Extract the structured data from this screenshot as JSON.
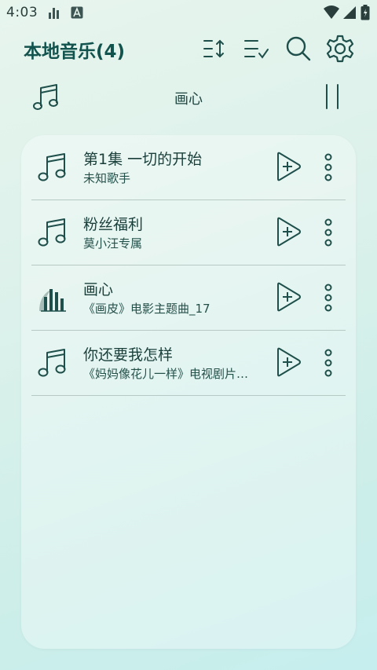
{
  "status_bar": {
    "time": "4:03",
    "icons_left": [
      "signal-bars-icon",
      "accessibility-a-icon"
    ],
    "icons_right": [
      "wifi-icon",
      "cell-signal-icon",
      "battery-icon"
    ]
  },
  "header": {
    "title": "本地音乐(4)",
    "actions": [
      "sort-icon",
      "multi-select-icon",
      "search-icon",
      "gear-icon"
    ]
  },
  "now_playing": {
    "title": "画心",
    "state_icon": "pause-icon"
  },
  "songs": [
    {
      "title": "第1集 一切的开始",
      "artist": "未知歌手",
      "icon": "music-note-icon",
      "playing": false
    },
    {
      "title": "粉丝福利",
      "artist": "莫小汪专属",
      "icon": "music-note-icon",
      "playing": false
    },
    {
      "title": "画心",
      "artist": "《画皮》电影主题曲_17",
      "icon": "equalizer-icon",
      "playing": true
    },
    {
      "title": "你还要我怎样",
      "artist": "《妈妈像花儿一样》电视剧片…",
      "icon": "music-note-icon",
      "playing": false
    }
  ],
  "colors": {
    "accent": "#12534e",
    "icon": "#1f4f4a",
    "divider": "#b7c9c4",
    "bg_top": "#e7f5ed",
    "bg_bottom": "#c6eeee"
  }
}
